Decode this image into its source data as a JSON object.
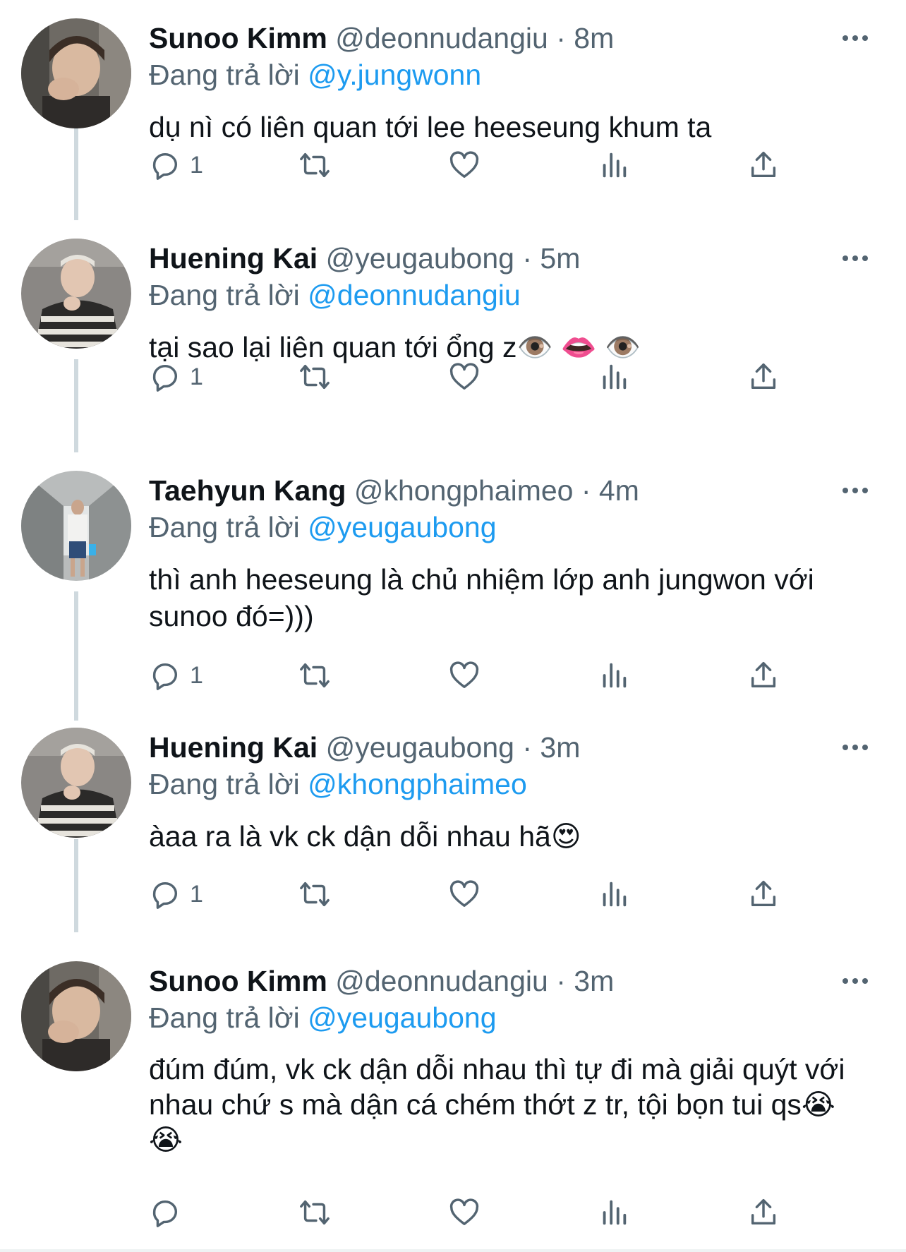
{
  "ui": {
    "replying_label": "Đang trả lời",
    "separator": "·"
  },
  "tweets": [
    {
      "name": "Sunoo Kimm",
      "handle": "@deonnudangiu",
      "time": "8m",
      "reply_to": "@y.jungwonn",
      "text": "dụ nì có liên quan tới lee heeseung khum ta",
      "reply_count": "1"
    },
    {
      "name": "Huening Kai",
      "handle": "@yeugaubong",
      "time": "5m",
      "reply_to": "@deonnudangiu",
      "text": "tại sao lại liên quan tới ổng z👁️ 👄 👁️",
      "reply_count": "1"
    },
    {
      "name": "Taehyun Kang",
      "handle": "@khongphaimeo",
      "time": "4m",
      "reply_to": "@yeugaubong",
      "text": "thì anh heeseung là chủ nhiệm lớp anh jungwon với sunoo đó=)))",
      "reply_count": "1"
    },
    {
      "name": "Huening Kai",
      "handle": "@yeugaubong",
      "time": "3m",
      "reply_to": "@khongphaimeo",
      "text": "àaa ra là vk ck dận dỗi nhau hã😍",
      "reply_count": "1"
    },
    {
      "name": "Sunoo Kimm",
      "handle": "@deonnudangiu",
      "time": "3m",
      "reply_to": "@yeugaubong",
      "text": "đúm đúm, vk ck dận dỗi nhau thì tự đi mà giải quýt với nhau chứ s mà dận cá chém thớt z tr, tội bọn tui qs😭 😭",
      "reply_count": ""
    }
  ],
  "icons": {
    "reply": "reply-icon",
    "retweet": "retweet-icon",
    "like": "heart-icon",
    "stats": "stats-icon",
    "share": "share-icon",
    "more": "more-icon"
  },
  "colors": {
    "link": "#1d9bf0",
    "secondary_text": "#536471",
    "primary_text": "#0f1419",
    "thread_line": "#cfd9de"
  }
}
